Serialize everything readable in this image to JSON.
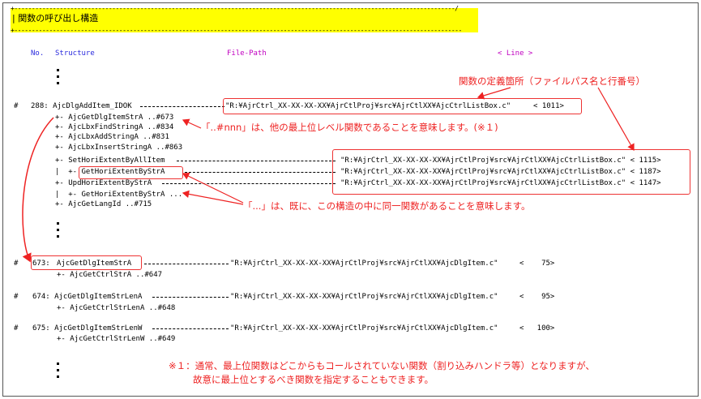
{
  "header": {
    "top_rule": "+------------------------------------------------------------------------------------------------------------------------------/",
    "title": "| 関数の呼び出し構造",
    "bottom_rule": "+--------------------------------------------------------------------------------------------------------------------------------"
  },
  "columns": {
    "no": "No.",
    "structure": "Structure",
    "file_path": "File-Path",
    "line": "< Line >"
  },
  "entries": {
    "e288": {
      "hash": "#",
      "head": "288: AjcDlgAddItem_IDOK",
      "path": "\"R:¥AjrCtrl_XX-XX-XX-XX¥AjrCtlProj¥src¥AjrCtlXX¥AjcCtrlListBox.c\"",
      "line": "< 1011>",
      "children": [
        "+- AjcGetDlgItemStrA ..#673",
        "+- AjcLbxFindStringA ..#834",
        "+- AjcLbxAddStringA ..#831",
        "+- AjcLbxInsertStringA ..#863",
        "+- SetHoriExtentByAllItem",
        "|  +- GetHoriExtentByStrA",
        "+- UpdHoriExtentByStrA",
        "|  +- GetHoriExtentByStrA ...",
        "+- AjcGetLangId ..#715"
      ],
      "sub_paths": [
        "\"R:¥AjrCtrl_XX-XX-XX-XX¥AjrCtlProj¥src¥AjrCtlXX¥AjcCtrlListBox.c\" < 1115>",
        "\"R:¥AjrCtrl_XX-XX-XX-XX¥AjrCtlProj¥src¥AjrCtlXX¥AjcCtrlListBox.c\" < 1187>",
        "\"R:¥AjrCtrl_XX-XX-XX-XX¥AjrCtlProj¥src¥AjrCtlXX¥AjcCtrlListBox.c\" < 1147>"
      ]
    },
    "e673": {
      "hash": "#",
      "no": "673:",
      "name": "AjcGetDlgItemStrA",
      "path": "\"R:¥AjrCtrl_XX-XX-XX-XX¥AjrCtlProj¥src¥AjrCtlXX¥AjcDlgItem.c\"",
      "line": "<    75>",
      "child": "+- AjcGetCtrlStrA ..#647"
    },
    "e674": {
      "hash": "#",
      "head": "674: AjcGetDlgItemStrLenA",
      "path": "\"R:¥AjrCtrl_XX-XX-XX-XX¥AjrCtlProj¥src¥AjrCtlXX¥AjcDlgItem.c\"",
      "line": "<    95>",
      "child": "+- AjcGetCtrlStrLenA ..#648"
    },
    "e675": {
      "hash": "#",
      "head": "675: AjcGetDlgItemStrLenW",
      "path": "\"R:¥AjrCtrl_XX-XX-XX-XX¥AjrCtlProj¥src¥AjrCtlXX¥AjcDlgItem.c\"",
      "line": "<   100>",
      "child": "+- AjcGetCtrlStrLenW ..#649"
    }
  },
  "annotations": {
    "definition": "関数の定義箇所（ファイルパス名と行番号）",
    "nnn": "「..#nnn」は、他の最上位レベル関数であることを意味します。(※１)",
    "ellipsis": "「...」は、既に、この構造の中に同一関数があることを意味します。",
    "note_line1": "※１：通常、最上位関数はどこからもコールされていない関数（割り込みハンドラ等）となりますが、",
    "note_line2": "故意に最上位とするべき関数を指定することもできます。"
  },
  "colors": {
    "header_bg": "#ffff00",
    "structure_blue": "#2a2add",
    "file_path_magenta": "#c000c0",
    "annotation_red": "#ee2222"
  }
}
